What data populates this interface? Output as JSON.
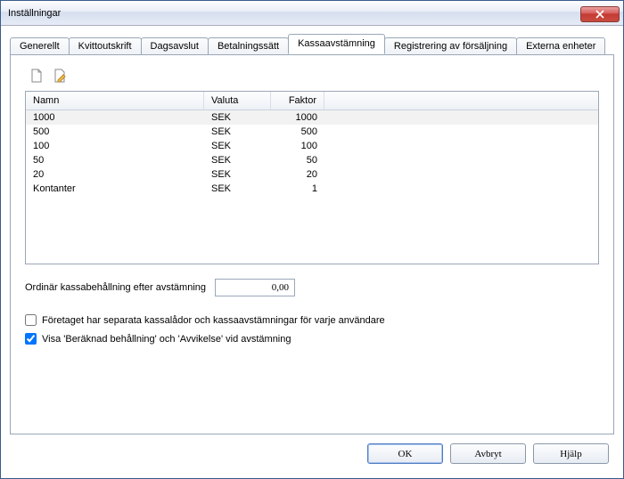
{
  "window": {
    "title": "Inställningar"
  },
  "tabs": [
    {
      "label": "Generellt"
    },
    {
      "label": "Kvittoutskrift"
    },
    {
      "label": "Dagsavslut"
    },
    {
      "label": "Betalningssätt"
    },
    {
      "label": "Kassaavstämning"
    },
    {
      "label": "Registrering av försäljning"
    },
    {
      "label": "Externa enheter"
    }
  ],
  "activeTab": 4,
  "grid": {
    "headers": {
      "name": "Namn",
      "currency": "Valuta",
      "factor": "Faktor"
    },
    "rows": [
      {
        "name": "1000",
        "currency": "SEK",
        "factor": "1000"
      },
      {
        "name": "500",
        "currency": "SEK",
        "factor": "500"
      },
      {
        "name": "100",
        "currency": "SEK",
        "factor": "100"
      },
      {
        "name": "50",
        "currency": "SEK",
        "factor": "50"
      },
      {
        "name": "20",
        "currency": "SEK",
        "factor": "20"
      },
      {
        "name": "Kontanter",
        "currency": "SEK",
        "factor": "1"
      }
    ]
  },
  "ordinary": {
    "label": "Ordinär kassabehållning efter avstämning",
    "value": "0,00"
  },
  "checks": {
    "separate": {
      "label": "Företaget har separata kassalådor och kassaavstämningar för varje användare",
      "checked": false
    },
    "showCalc": {
      "label": "Visa 'Beräknad behållning' och 'Avvikelse' vid avstämning",
      "checked": true
    }
  },
  "footer": {
    "ok": "OK",
    "cancel": "Avbryt",
    "help": "Hjälp"
  }
}
